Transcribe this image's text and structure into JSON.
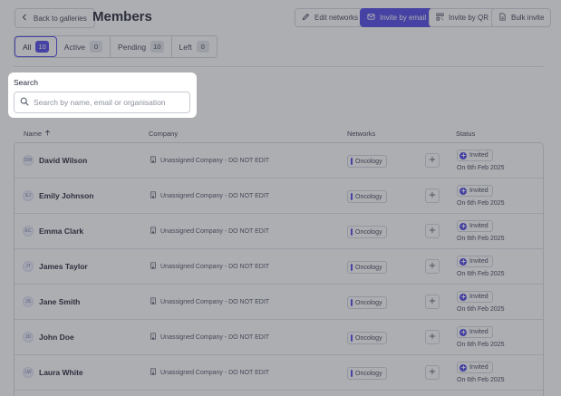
{
  "header": {
    "back_label": "Back to galleries",
    "title": "Members",
    "edit_networks_label": "Edit networks",
    "invite_email_label": "Invite by email",
    "invite_qr_label": "Invite by QR",
    "bulk_invite_label": "Bulk invite"
  },
  "tabs": [
    {
      "label": "All",
      "count": "10",
      "active": true
    },
    {
      "label": "Active",
      "count": "0"
    },
    {
      "label": "Pending",
      "count": "10"
    },
    {
      "label": "Left",
      "count": "0"
    }
  ],
  "search": {
    "label": "Search",
    "placeholder": "Search by name, email or organisation"
  },
  "table": {
    "columns": {
      "name": "Name",
      "company": "Company",
      "networks": "Networks",
      "status": "Status"
    },
    "rows": [
      {
        "initials": "DW",
        "name": "David Wilson",
        "company": "Unassigned Company - DO NOT EDIT",
        "network": "Oncology",
        "status": "Invited",
        "date": "On 6th Feb 2025"
      },
      {
        "initials": "EJ",
        "name": "Emily Johnson",
        "company": "Unassigned Company - DO NOT EDIT",
        "network": "Oncology",
        "status": "Invited",
        "date": "On 6th Feb 2025"
      },
      {
        "initials": "EC",
        "name": "Emma Clark",
        "company": "Unassigned Company - DO NOT EDIT",
        "network": "Oncology",
        "status": "Invited",
        "date": "On 6th Feb 2025"
      },
      {
        "initials": "JT",
        "name": "James Taylor",
        "company": "Unassigned Company - DO NOT EDIT",
        "network": "Oncology",
        "status": "Invited",
        "date": "On 6th Feb 2025"
      },
      {
        "initials": "JS",
        "name": "Jane Smith",
        "company": "Unassigned Company - DO NOT EDIT",
        "network": "Oncology",
        "status": "Invited",
        "date": "On 6th Feb 2025"
      },
      {
        "initials": "JD",
        "name": "John Doe",
        "company": "Unassigned Company - DO NOT EDIT",
        "network": "Oncology",
        "status": "Invited",
        "date": "On 6th Feb 2025"
      },
      {
        "initials": "LW",
        "name": "Laura White",
        "company": "Unassigned Company - DO NOT EDIT",
        "network": "Oncology",
        "status": "Invited",
        "date": "On 6th Feb 2025"
      }
    ]
  },
  "colors": {
    "accent": "#4f46e5",
    "overlay": "#3c3e48"
  }
}
